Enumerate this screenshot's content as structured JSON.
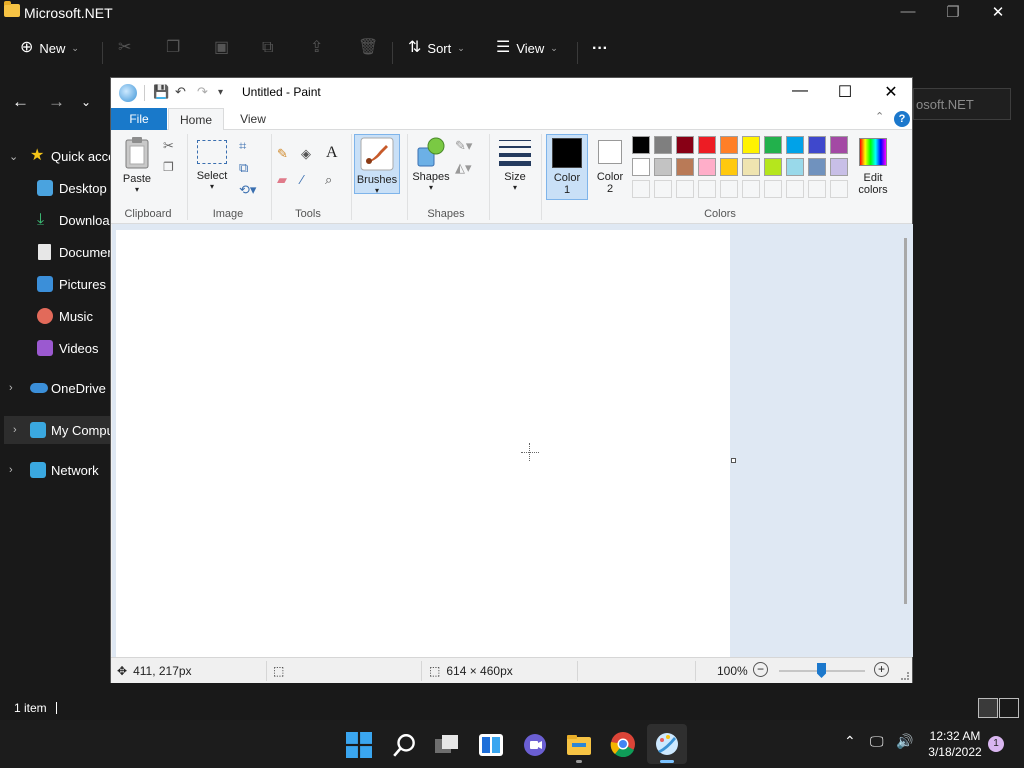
{
  "explorer": {
    "title": "Microsoft.NET",
    "window_controls": [
      "—",
      "❐",
      "✕"
    ],
    "commands": {
      "new": "New",
      "sort": "Sort",
      "view": "View",
      "more": "···"
    },
    "address_text": "osoft.NET",
    "sidebar": [
      {
        "label": "Quick acce",
        "icon": "star-icon",
        "color": "#f5c518"
      },
      {
        "label": "Desktop",
        "icon": "desktop-icon",
        "color": "#4aa3df"
      },
      {
        "label": "Download",
        "icon": "download-icon",
        "color": "#3ec27a"
      },
      {
        "label": "Documen",
        "icon": "document-icon",
        "color": "#e7e7e7"
      },
      {
        "label": "Pictures",
        "icon": "pictures-icon",
        "color": "#3b8fd9"
      },
      {
        "label": "Music",
        "icon": "music-icon",
        "color": "#e26a5a"
      },
      {
        "label": "Videos",
        "icon": "videos-icon",
        "color": "#9b59d0"
      },
      {
        "label": "OneDrive",
        "icon": "onedrive-icon",
        "color": "#3b8fd9"
      },
      {
        "label": "My Compu",
        "icon": "computer-icon",
        "color": "#3aa8e0"
      },
      {
        "label": "Network",
        "icon": "network-icon",
        "color": "#3aa8e0"
      }
    ],
    "status": "1 item"
  },
  "paint": {
    "title": "Untitled - Paint",
    "tabs": {
      "file": "File",
      "home": "Home",
      "view": "View"
    },
    "help": "?",
    "groups": {
      "clipboard": "Clipboard",
      "image": "Image",
      "tools": "Tools",
      "shapes": "Shapes",
      "colors": "Colors"
    },
    "buttons": {
      "paste": "Paste",
      "select": "Select",
      "brushes": "Brushes",
      "shapes": "Shapes",
      "size": "Size",
      "color1_line1": "Color",
      "color1_line2": "1",
      "color2_line1": "Color",
      "color2_line2": "2",
      "edit_colors_line1": "Edit",
      "edit_colors_line2": "colors",
      "text_tool": "A"
    },
    "color1": "#000000",
    "color2": "#ffffff",
    "palette_row1": [
      "#000000",
      "#7f7f7f",
      "#880015",
      "#ed1c24",
      "#ff7f27",
      "#fff200",
      "#22b14c",
      "#00a2e8",
      "#3f48cc",
      "#a349a4"
    ],
    "palette_row2": [
      "#ffffff",
      "#c3c3c3",
      "#b97a57",
      "#ffaec9",
      "#ffc90e",
      "#efe4b0",
      "#b5e61d",
      "#99d9ea",
      "#7092be",
      "#c8bfe7"
    ],
    "status": {
      "cursor_pos": "411, 217px",
      "canvas_size": "614 × 460px",
      "zoom": "100%",
      "zoom_level": 0.5
    }
  },
  "taskbar": {
    "time": "12:32 AM",
    "date": "3/18/2022",
    "notifications": "1"
  }
}
